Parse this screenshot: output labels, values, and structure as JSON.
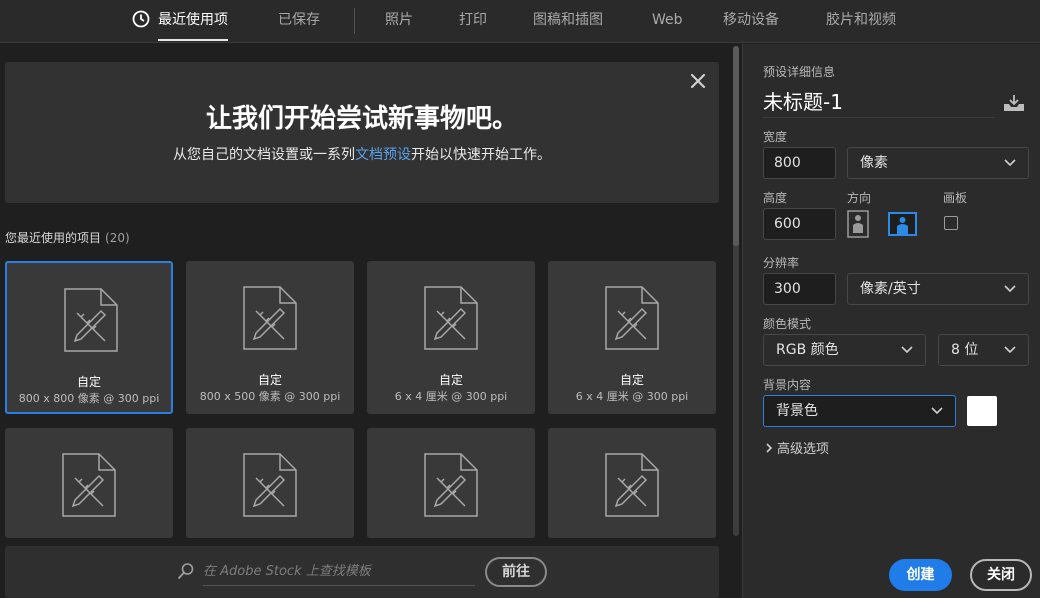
{
  "tabs": [
    {
      "label": "最近使用项",
      "active": true
    },
    {
      "label": "已保存"
    },
    {
      "label": "照片"
    },
    {
      "label": "打印"
    },
    {
      "label": "图稿和插图"
    },
    {
      "label": "Web"
    },
    {
      "label": "移动设备"
    },
    {
      "label": "胶片和视频"
    }
  ],
  "banner": {
    "title": "让我们开始尝试新事物吧。",
    "sub_before": "从您自己的文档设置或一系列",
    "sub_link": "文档预设",
    "sub_after": "开始以快速开始工作。"
  },
  "recent": {
    "label": "您最近使用的项目",
    "count": "(20)",
    "items": [
      {
        "name": "自定",
        "meta": "800 x 800 像素 @ 300 ppi"
      },
      {
        "name": "自定",
        "meta": "800 x 500 像素 @ 300 ppi"
      },
      {
        "name": "自定",
        "meta": "6 x 4 厘米 @ 300 ppi"
      },
      {
        "name": "自定",
        "meta": "6 x 4 厘米 @ 300 ppi"
      }
    ]
  },
  "stock": {
    "placeholder": "在 Adobe Stock 上查找模板",
    "go_label": "前往"
  },
  "details": {
    "section_label": "预设详细信息",
    "title": "未标题-1",
    "width_label": "宽度",
    "width_value": "800",
    "width_unit": "像素",
    "height_label": "高度",
    "height_value": "600",
    "orientation_label": "方向",
    "artboard_label": "画板",
    "resolution_label": "分辨率",
    "resolution_value": "300",
    "resolution_unit": "像素/英寸",
    "color_mode_label": "颜色模式",
    "color_mode_value": "RGB 颜色",
    "bit_depth_value": "8 位",
    "background_label": "背景内容",
    "background_value": "背景色",
    "background_swatch": "#ffffff",
    "advanced_label": "高级选项",
    "create_label": "创建",
    "close_label": "关闭"
  }
}
